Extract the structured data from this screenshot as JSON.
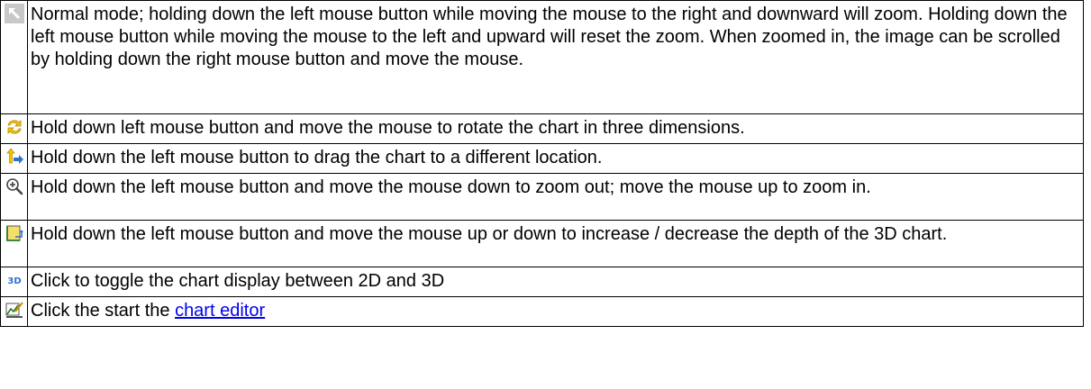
{
  "rows": [
    {
      "icon": "pointer-arrow-icon",
      "text": "Normal mode; holding down the left mouse button while moving the mouse to the right and downward will zoom. Holding down the left mouse button while moving the mouse to the left and upward will reset the zoom. When zoomed in, the image can be scrolled by holding down the right mouse button and move the mouse."
    },
    {
      "icon": "rotate-icon",
      "text": "Hold down left mouse button and move the mouse to rotate the chart in three dimensions."
    },
    {
      "icon": "move-icon",
      "text": "Hold down the left mouse button to drag the chart to a different location."
    },
    {
      "icon": "zoom-icon",
      "text": "Hold down the left mouse button and move the mouse down to zoom out; move the mouse up to zoom in."
    },
    {
      "icon": "depth-icon",
      "text": "Hold down the left mouse button and move the mouse up or down to increase / decrease the depth of the 3D chart."
    },
    {
      "icon": "toggle-3d-icon",
      "icon_text": "3D",
      "text": "Click to toggle the chart display between 2D and 3D"
    },
    {
      "icon": "chart-editor-icon",
      "text": "Click the start the ",
      "link": "chart editor"
    }
  ],
  "colors": {
    "border": "#000000",
    "link": "#0000ee",
    "icon_gray": "#c8c8c8",
    "icon_yellow": "#f3c500",
    "icon_blue": "#2f6fd0"
  }
}
